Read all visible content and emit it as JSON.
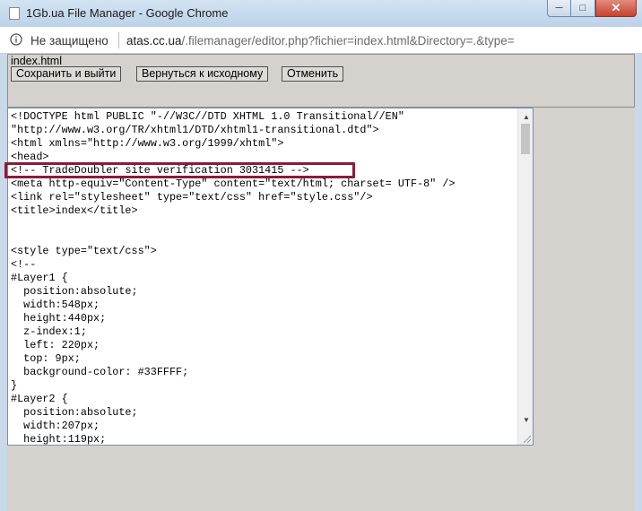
{
  "window": {
    "title": "1Gb.ua File Manager - Google Chrome",
    "buttons": {
      "minimize": "─",
      "maximize": "□",
      "close": "✕"
    }
  },
  "address_bar": {
    "security_label": "Не защищено",
    "url_host": "atas.cc.ua",
    "url_path": "/.filemanager/editor.php?fichier=index.html&Directory=.&type="
  },
  "toolbar": {
    "filename": "index.html",
    "save_and_exit_label": "Сохранить и выйти",
    "revert_label": "Вернуться к исходному",
    "cancel_label": "Отменить"
  },
  "editor": {
    "lines": [
      "<!DOCTYPE html PUBLIC \"-//W3C//DTD XHTML 1.0 Transitional//EN\"",
      "\"http://www.w3.org/TR/xhtml1/DTD/xhtml1-transitional.dtd\">",
      "<html xmlns=\"http://www.w3.org/1999/xhtml\">",
      "<head>",
      "<!-- TradeDoubler site verification 3031415 -->",
      "<meta http-equiv=\"Content-Type\" content=\"text/html; charset= UTF-8\" />",
      "<link rel=\"stylesheet\" type=\"text/css\" href=\"style.css\"/>",
      "<title>index</title>",
      "",
      "",
      "<style type=\"text/css\">",
      "<!--",
      "#Layer1 {",
      "  position:absolute;",
      "  width:548px;",
      "  height:440px;",
      "  z-index:1;",
      "  left: 220px;",
      "  top: 9px;",
      "  background-color: #33FFFF;",
      "}",
      "#Layer2 {",
      "  position:absolute;",
      "  width:207px;",
      "  height:119px;"
    ]
  },
  "colors": {
    "highlight_border": "#8b1b3c",
    "titlebar": "#c9d9ea",
    "page_background": "#d5d2ce"
  }
}
